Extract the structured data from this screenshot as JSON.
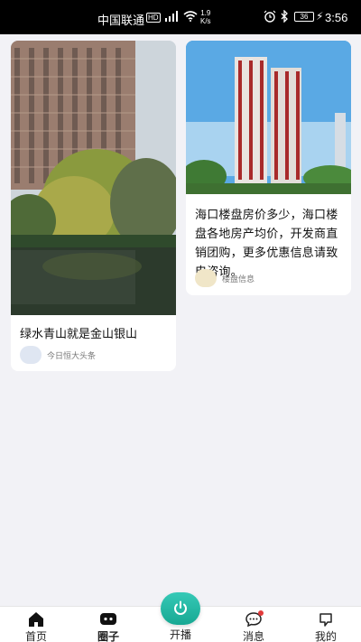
{
  "status_bar": {
    "carrier": "中国联通",
    "hd": "HD",
    "signal_tag": "4G",
    "speed_value": "1.9",
    "speed_unit": "K/s",
    "battery": "36",
    "time": "3:56"
  },
  "feed": {
    "cards": [
      {
        "title": "绿水青山就是金山银山",
        "author": "今日恒大头条",
        "image": "lakeside-apartment-photo"
      },
      {
        "title": "海口楼盘房价多少，海口楼盘各地房产均价，开发商直销团购，更多优惠信息请致电咨询。",
        "author": "楼盘信息",
        "image": "tower-rendering-photo"
      }
    ]
  },
  "bottom_nav": {
    "home": "首页",
    "circle": "圈子",
    "live": "开播",
    "messages": "消息",
    "mine": "我的"
  },
  "colors": {
    "accent": "#1fb8a4",
    "badge": "#e23b3b",
    "background": "#f2f2f6"
  }
}
